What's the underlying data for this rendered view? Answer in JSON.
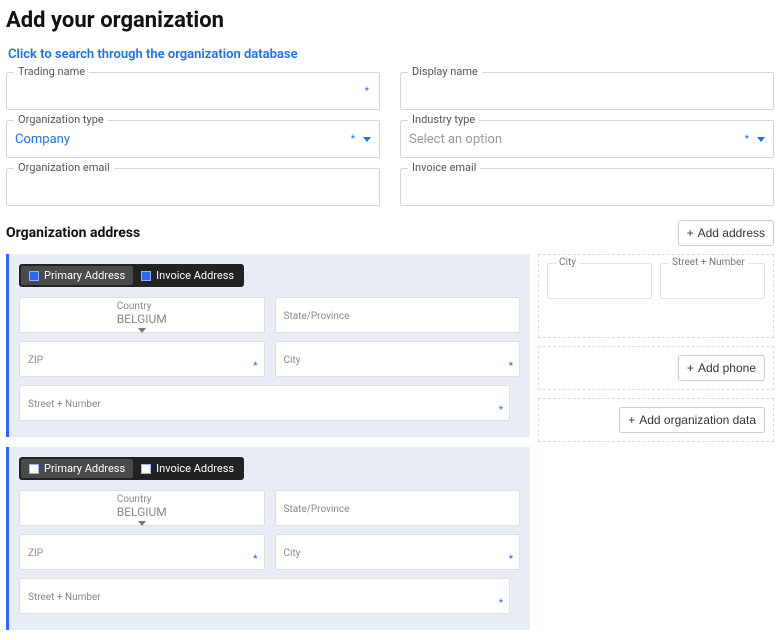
{
  "header": {
    "title": "Add your organization",
    "search_link": "Click to search through the organization database"
  },
  "fields": {
    "trading_name_label": "Trading name",
    "display_name_label": "Display name",
    "org_type_label": "Organization type",
    "org_type_value": "Company",
    "industry_type_label": "Industry type",
    "industry_type_placeholder": "Select an option",
    "org_email_label": "Organization email",
    "invoice_email_label": "Invoice email"
  },
  "section": {
    "address_title": "Organization address",
    "add_address": "Add address",
    "add_phone": "Add phone",
    "add_org_data": "Add organization data"
  },
  "address_tabs": {
    "primary": "Primary Address",
    "invoice": "Invoice Address"
  },
  "address_labels": {
    "country": "Country",
    "country_value": "BELGIUM",
    "state": "State/Province",
    "zip": "ZIP",
    "city": "City",
    "street": "Street + Number"
  },
  "ghost": {
    "city": "City",
    "street": "Street + Number"
  },
  "plus": "+"
}
